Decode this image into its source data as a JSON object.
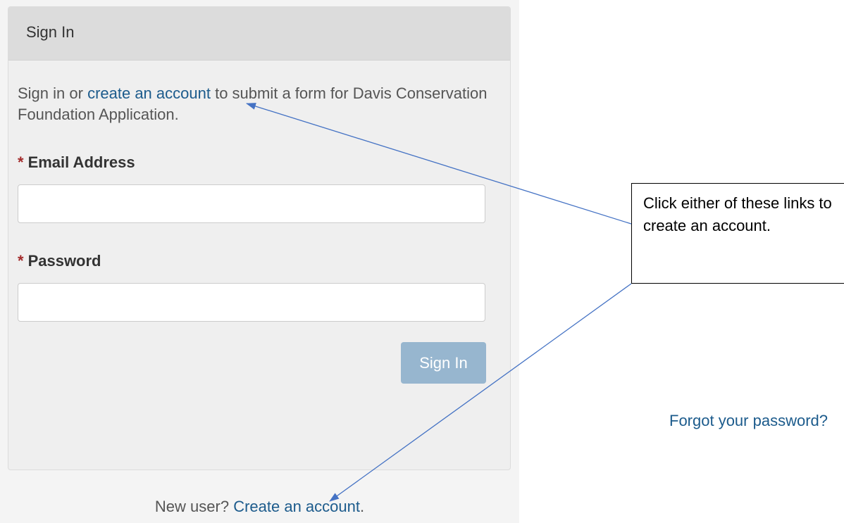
{
  "panel": {
    "title": "Sign In",
    "intro": {
      "prefix": "Sign in or ",
      "link": "create an account",
      "suffix": " to submit a form for Davis Conservation Foundation Application."
    },
    "required_marker": "*",
    "email": {
      "label": "Email Address",
      "value": "",
      "placeholder": ""
    },
    "password": {
      "label": "Password",
      "value": "",
      "placeholder": ""
    },
    "signin_button": "Sign In",
    "forgot_link": "Forgot your password?"
  },
  "footer": {
    "prefix": "New user? ",
    "link": "Create an account",
    "suffix": "."
  },
  "annotation": {
    "text": "Click either of these links to create an account."
  },
  "colors": {
    "link": "#1c5b8c",
    "required": "#a32b2b",
    "button_disabled": "#97b6cf",
    "arrow": "#4472c4"
  }
}
